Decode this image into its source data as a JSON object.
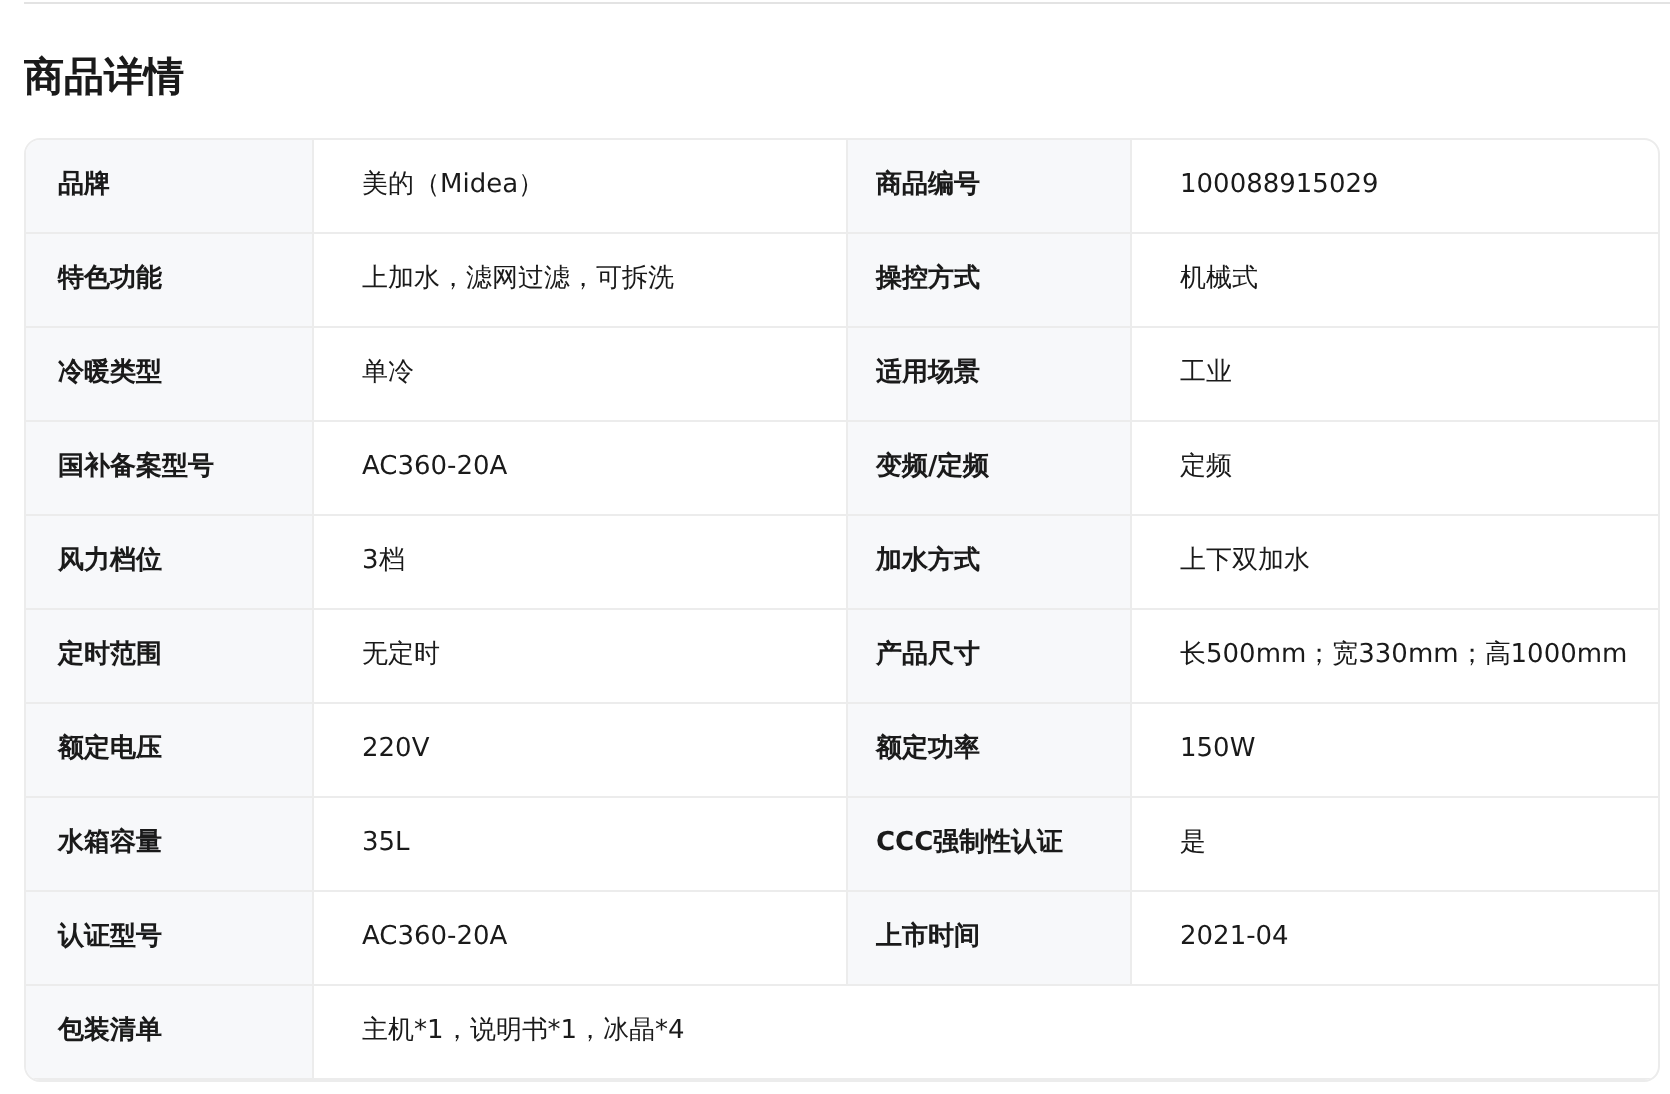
{
  "title": "商品详情",
  "rows": [
    {
      "cells": [
        {
          "label": "品牌",
          "value": "美的（Midea）"
        },
        {
          "label": "商品编号",
          "value": "100088915029"
        }
      ]
    },
    {
      "cells": [
        {
          "label": "特色功能",
          "value": "上加水，滤网过滤，可拆洗"
        },
        {
          "label": "操控方式",
          "value": "机械式"
        }
      ]
    },
    {
      "cells": [
        {
          "label": "冷暖类型",
          "value": "单冷"
        },
        {
          "label": "适用场景",
          "value": "工业"
        }
      ]
    },
    {
      "cells": [
        {
          "label": "国补备案型号",
          "value": "AC360-20A"
        },
        {
          "label": "变频/定频",
          "value": "定频"
        }
      ]
    },
    {
      "cells": [
        {
          "label": "风力档位",
          "value": "3档"
        },
        {
          "label": "加水方式",
          "value": "上下双加水"
        }
      ]
    },
    {
      "cells": [
        {
          "label": "定时范围",
          "value": "无定时"
        },
        {
          "label": "产品尺寸",
          "value": "长500mm；宽330mm；高1000mm"
        }
      ]
    },
    {
      "cells": [
        {
          "label": "额定电压",
          "value": "220V"
        },
        {
          "label": "额定功率",
          "value": "150W"
        }
      ]
    },
    {
      "cells": [
        {
          "label": "水箱容量",
          "value": "35L"
        },
        {
          "label": "CCC强制性认证",
          "value": "是"
        }
      ]
    },
    {
      "cells": [
        {
          "label": "认证型号",
          "value": "AC360-20A"
        },
        {
          "label": "上市时间",
          "value": "2021-04"
        }
      ]
    },
    {
      "cells": [
        {
          "label": "包装清单",
          "value": "主机*1，说明书*1，冰晶*4"
        }
      ]
    }
  ]
}
